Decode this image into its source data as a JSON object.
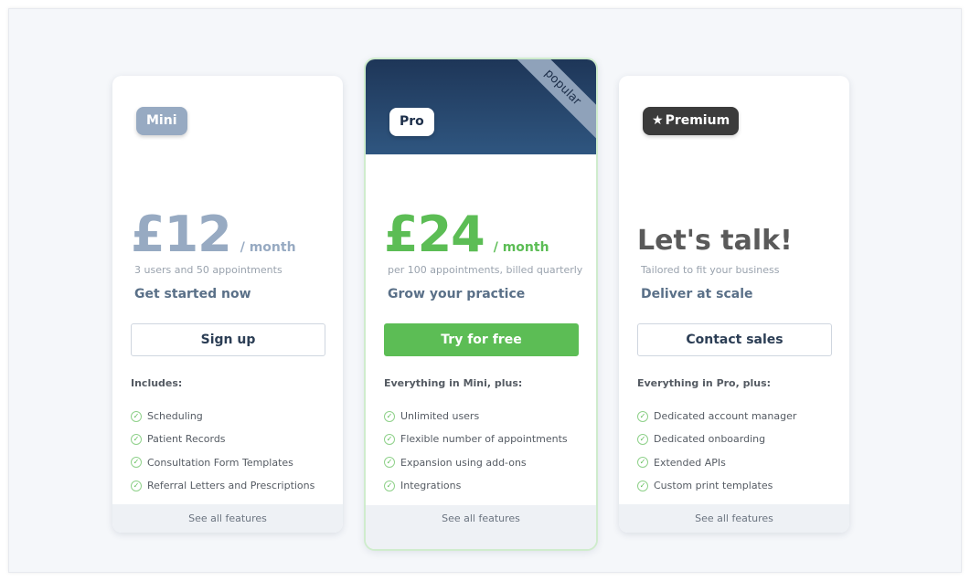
{
  "plans": {
    "mini": {
      "badge": "Mini",
      "price": "£12",
      "per": "/ month",
      "sub": "3 users and 50 appointments",
      "tagline": "Get started now",
      "cta": "Sign up",
      "includes": "Includes:",
      "features": [
        "Scheduling",
        "Patient Records",
        "Consultation Form Templates",
        "Referral Letters and Prescriptions"
      ],
      "footer": "See all features"
    },
    "pro": {
      "ribbon": "popular",
      "badge": "Pro",
      "price": "£24",
      "per": "/ month",
      "sub": "per 100 appointments, billed quarterly",
      "tagline": "Grow your practice",
      "cta": "Try for free",
      "includes": "Everything in Mini, plus:",
      "features": [
        "Unlimited users",
        "Flexible number of appointments",
        "Expansion using add-ons",
        "Integrations"
      ],
      "footer": "See all features"
    },
    "premium": {
      "badge_icon": "star-icon",
      "badge": "Premium",
      "headline": "Let's talk!",
      "sub": "Tailored to fit your business",
      "tagline": "Deliver at scale",
      "cta": "Contact sales",
      "includes": "Everything in Pro, plus:",
      "features": [
        "Dedicated account manager",
        "Dedicated onboarding",
        "Extended APIs",
        "Custom print templates"
      ],
      "footer": "See all features"
    }
  },
  "icons": {
    "feature": "check-circle-icon"
  },
  "colors": {
    "pro_green": "#5cbd55",
    "mini_slate": "#97aac2",
    "pro_header_navy": "#1e3658",
    "premium_dark": "#3b3b3b"
  }
}
